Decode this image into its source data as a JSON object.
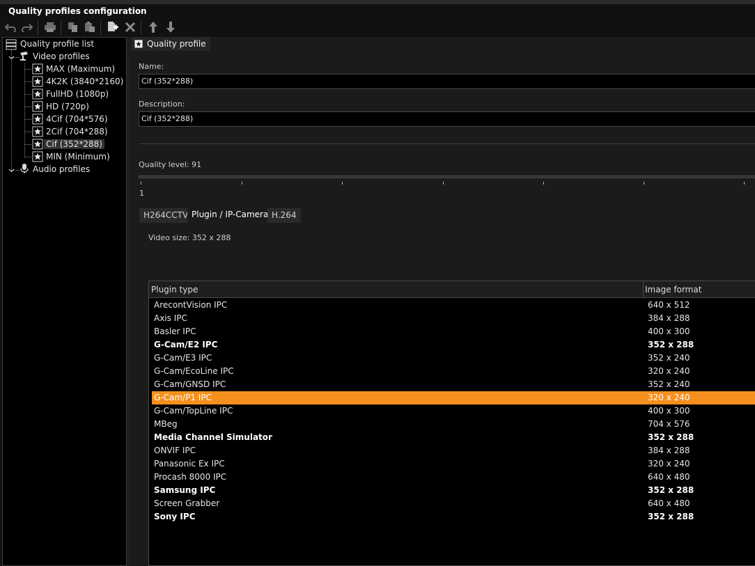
{
  "window": {
    "title": "Quality profiles configuration"
  },
  "toolbar": {
    "buttons": [
      {
        "name": "undo-icon"
      },
      {
        "name": "redo-icon"
      },
      {
        "name": "print-icon"
      },
      {
        "name": "copy-icon"
      },
      {
        "name": "paste-icon"
      },
      {
        "name": "add-document-icon"
      },
      {
        "name": "delete-icon"
      },
      {
        "name": "arrow-up-icon"
      },
      {
        "name": "arrow-down-icon"
      }
    ]
  },
  "tree": {
    "root_label": "Quality profile list",
    "video_label": "Video profiles",
    "audio_label": "Audio profiles",
    "video_items": [
      "MAX (Maximum)",
      "4K2K (3840*2160)",
      "FullHD (1080p)",
      "HD (720p)",
      "4Cif (704*576)",
      "2Cif (704*288)",
      "Cif (352*288)",
      "MIN (Minimum)"
    ],
    "selected_index": 6
  },
  "panel": {
    "tab_label": "Quality profile",
    "name_label": "Name:",
    "name_value": "Cif (352*288)",
    "description_label": "Description:",
    "description_value": "Cif (352*288)",
    "quality_label": "Quality level: 91",
    "quality_level": 91,
    "slider_min_label": "1",
    "subtabs": [
      "H264CCTV",
      "Plugin / IP-Camera",
      "H.264"
    ],
    "active_subtab": 1,
    "video_size": "Video size: 352 x 288"
  },
  "table": {
    "headers": [
      "Plugin type",
      "Image format"
    ],
    "rows": [
      {
        "plugin": "ArecontVision IPC",
        "format": "640 x 512",
        "bold": false
      },
      {
        "plugin": "Axis IPC",
        "format": "384 x 288",
        "bold": false
      },
      {
        "plugin": "Basler IPC",
        "format": "400 x 300",
        "bold": false
      },
      {
        "plugin": "G-Cam/E2 IPC",
        "format": "352 x 288",
        "bold": true
      },
      {
        "plugin": "G-Cam/E3 IPC",
        "format": "352 x 240",
        "bold": false
      },
      {
        "plugin": "G-Cam/EcoLine IPC",
        "format": "320 x 240",
        "bold": false
      },
      {
        "plugin": "G-Cam/GNSD IPC",
        "format": "352 x 240",
        "bold": false
      },
      {
        "plugin": "G-Cam/P1 IPC",
        "format": "320 x 240",
        "bold": false,
        "selected": true
      },
      {
        "plugin": "G-Cam/TopLine IPC",
        "format": "400 x 300",
        "bold": false
      },
      {
        "plugin": "MBeg",
        "format": "704 x 576",
        "bold": false
      },
      {
        "plugin": "Media Channel Simulator",
        "format": "352 x 288",
        "bold": true
      },
      {
        "plugin": "ONVIF IPC",
        "format": "384 x 288",
        "bold": false
      },
      {
        "plugin": "Panasonic Ex IPC",
        "format": "320 x 240",
        "bold": false
      },
      {
        "plugin": "Procash 8000 IPC",
        "format": "640 x 480",
        "bold": false
      },
      {
        "plugin": "Samsung IPC",
        "format": "352 x 288",
        "bold": true
      },
      {
        "plugin": "Screen Grabber",
        "format": "640 x 480",
        "bold": false
      },
      {
        "plugin": "Sony IPC",
        "format": "352 x 288",
        "bold": true
      }
    ]
  },
  "colors": {
    "selection": "#f5901e",
    "background": "#000000"
  }
}
